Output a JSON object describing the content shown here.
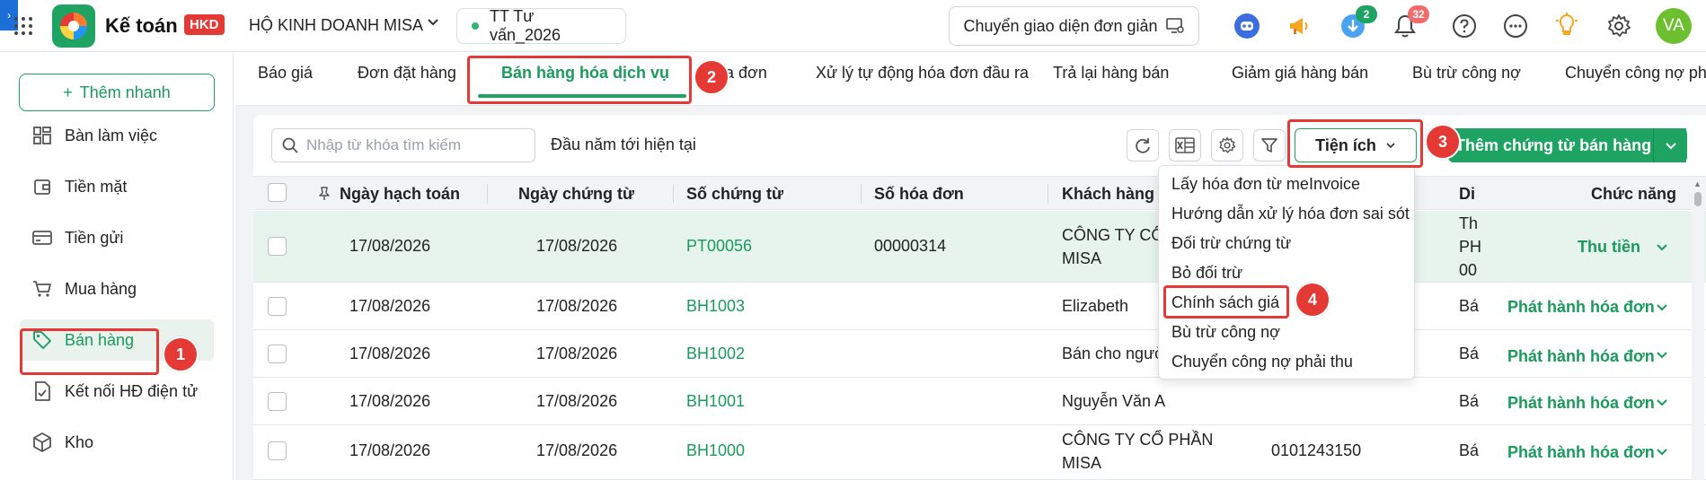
{
  "header": {
    "corner_glyph": "›",
    "app_title": "Kế toán",
    "app_badge": "HKD",
    "company": "HỘ KINH DOANH MISA",
    "unit": "TT Tư vấn_2026",
    "simple_ui_label": "Chuyển giao diện đơn giản",
    "download_badge": "2",
    "notification_badge": "32",
    "avatar": "VA",
    "icons": [
      "apps-grid-icon",
      "robot-icon",
      "megaphone-icon",
      "download-icon",
      "bell-icon",
      "help-icon",
      "more-icon",
      "lightbulb-icon",
      "settings-icon"
    ]
  },
  "sidebar": {
    "quick_add": "Thêm nhanh",
    "items": [
      {
        "label": "Bàn làm việc",
        "icon": "dashboard-icon"
      },
      {
        "label": "Tiền mặt",
        "icon": "wallet-icon"
      },
      {
        "label": "Tiền gửi",
        "icon": "card-icon"
      },
      {
        "label": "Mua hàng",
        "icon": "cart-icon"
      },
      {
        "label": "Bán hàng",
        "icon": "tag-icon",
        "active": true
      },
      {
        "label": "Kết nối HĐ điện tử",
        "icon": "einvoice-icon"
      },
      {
        "label": "Kho",
        "icon": "box-icon"
      }
    ]
  },
  "tabs": [
    {
      "label": "Báo giá"
    },
    {
      "label": "Đơn đặt hàng"
    },
    {
      "label": "Bán hàng hóa dịch vụ",
      "active": true
    },
    {
      "label": "a đơn"
    },
    {
      "label": "Xử lý tự động hóa đơn đầu ra"
    },
    {
      "label": "Trả lại hàng bán"
    },
    {
      "label": "Giảm giá hàng bán"
    },
    {
      "label": "Bù trừ công nợ"
    },
    {
      "label": "Chuyển công nợ ph"
    }
  ],
  "toolbar": {
    "search_placeholder": "Nhập từ khóa tìm kiếm",
    "period": "Đầu năm tới hiện tại",
    "tool_icons": [
      "refresh-icon",
      "excel-icon",
      "settings-icon",
      "filter-icon"
    ],
    "utility_label": "Tiện ích",
    "add_label": "Thêm chứng từ bán hàng"
  },
  "table": {
    "columns": [
      "Ngày hạch toán",
      "Ngày chứng từ",
      "Số chứng từ",
      "Số hóa đơn",
      "Khách hàng",
      "Di",
      "Chức năng"
    ],
    "rows": [
      {
        "posting_date": "17/08/2026",
        "doc_date": "17/08/2026",
        "doc_no": "PT00056",
        "invoice_no": "00000314",
        "customer": "CÔNG TY CỔ\nMISA",
        "tax_code": "",
        "desc": "Th\nPH\n00",
        "action": "Thu tiền",
        "highlight": true
      },
      {
        "posting_date": "17/08/2026",
        "doc_date": "17/08/2026",
        "doc_no": "BH1003",
        "invoice_no": "",
        "customer": "Elizabeth",
        "tax_code": "",
        "desc": "Bá",
        "action": "Phát hành hóa đơn"
      },
      {
        "posting_date": "17/08/2026",
        "doc_date": "17/08/2026",
        "doc_no": "BH1002",
        "invoice_no": "",
        "customer": "Bán cho ngườ",
        "tax_code": "",
        "desc": "Bá",
        "action": "Phát hành hóa đơn"
      },
      {
        "posting_date": "17/08/2026",
        "doc_date": "17/08/2026",
        "doc_no": "BH1001",
        "invoice_no": "",
        "customer": "Nguyễn Văn A",
        "tax_code": "",
        "desc": "Bá",
        "action": "Phát hành hóa đơn"
      },
      {
        "posting_date": "17/08/2026",
        "doc_date": "17/08/2026",
        "doc_no": "BH1000",
        "invoice_no": "",
        "customer": "CÔNG TY CỔ PHẦN\nMISA",
        "tax_code": "0101243150",
        "desc": "Bá",
        "action": "Phát hành hóa đơn"
      }
    ]
  },
  "utility_menu": [
    "Lấy hóa đơn từ meInvoice",
    "Hướng dẫn xử lý hóa đơn sai sót",
    "Đối trừ chứng từ",
    "Bỏ đối trừ",
    "Chính sách giá",
    "Bù trừ công nợ",
    "Chuyển công nợ phải thu"
  ],
  "callouts": [
    "1",
    "2",
    "3",
    "4"
  ],
  "colors": {
    "accent": "#1ea362",
    "callout": "#e53935",
    "brand_badge": "#e53935"
  }
}
